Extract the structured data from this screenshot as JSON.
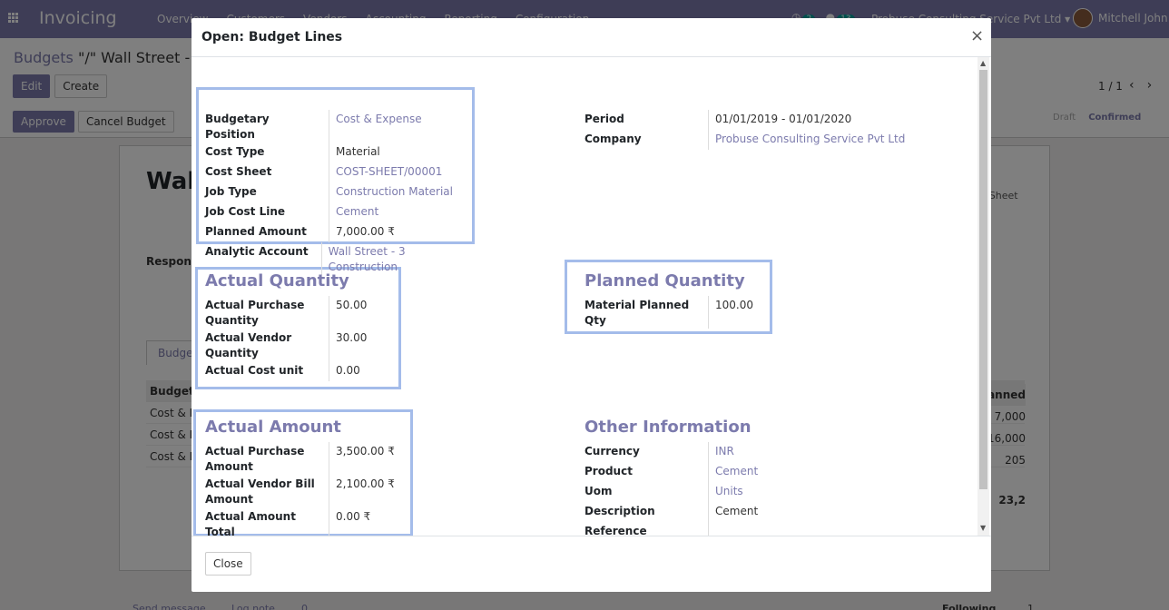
{
  "app": {
    "brand": "Invoicing",
    "menu": [
      "Overview",
      "Customers",
      "Vendors",
      "Accounting",
      "Reporting",
      "Configuration"
    ],
    "activity_count": "2",
    "message_count": "13",
    "company": "Probuse Consulting Service Pvt Ltd",
    "user": "Mitchell John"
  },
  "control_panel": {
    "breadcrumb_parent": "Budgets",
    "breadcrumb_current": "\"/\" Wall Street - 3 C",
    "edit_label": "Edit",
    "create_label": "Create",
    "pager": "1 / 1",
    "approve_label": "Approve",
    "cancel_budget_label": "Cancel Budget",
    "stage_draft": "Draft",
    "stage_confirmed": "Confirmed"
  },
  "sheet": {
    "title": "Wall",
    "responsible_label": "Respons",
    "tab_label": "Budget",
    "right_label_1": "t Sheet",
    "right_label_2": "s",
    "table_header": "Budgeta",
    "table_header_right": "lanned",
    "rows": [
      "Cost & E",
      "Cost & E",
      "Cost & E"
    ],
    "right_values": [
      "7,000",
      "16,000",
      "205"
    ],
    "total": "23,2"
  },
  "footer": {
    "send_message": "Send message",
    "log_note": "Log note",
    "attachments": "0",
    "following": "Following",
    "followers": "1"
  },
  "modal": {
    "title": "Open: Budget Lines",
    "close_label": "Close",
    "main_fields": [
      {
        "label": "Budgetary Position",
        "value": "Cost & Expense",
        "link": true
      },
      {
        "label": "Cost Type",
        "value": "Material",
        "link": false
      },
      {
        "label": "Cost Sheet",
        "value": "COST-SHEET/00001",
        "link": true
      },
      {
        "label": "Job Type",
        "value": "Construction Material",
        "link": true
      },
      {
        "label": "Job Cost Line",
        "value": "Cement",
        "link": true
      },
      {
        "label": "Planned Amount",
        "value": "7,000.00 ₹",
        "link": false
      },
      {
        "label": "Analytic Account",
        "value": "Wall Street - 3 Construction",
        "link": true
      }
    ],
    "right_fields": [
      {
        "label": "Period",
        "value": "01/01/2019 - 01/01/2020",
        "link": false
      },
      {
        "label": "Company",
        "value": "Probuse Consulting Service Pvt Ltd",
        "link": true
      }
    ],
    "actual_quantity": {
      "title": "Actual Quantity",
      "fields": [
        {
          "label": "Actual Purchase Quantity",
          "value": "50.00"
        },
        {
          "label": "Actual Vendor Quantity",
          "value": "30.00"
        },
        {
          "label": "Actual Cost unit",
          "value": "0.00"
        }
      ]
    },
    "planned_quantity": {
      "title": "Planned Quantity",
      "fields": [
        {
          "label": "Material Planned Qty",
          "value": "100.00"
        }
      ]
    },
    "actual_amount": {
      "title": "Actual Amount",
      "fields": [
        {
          "label": "Actual Purchase Amount",
          "value": "3,500.00 ₹"
        },
        {
          "label": "Actual Vendor Bill Amount",
          "value": "2,100.00 ₹"
        },
        {
          "label": "Actual Amount Total",
          "value": "0.00 ₹"
        }
      ]
    },
    "other_information": {
      "title": "Other Information",
      "fields": [
        {
          "label": "Currency",
          "value": "INR",
          "link": true
        },
        {
          "label": "Product",
          "value": "Cement",
          "link": true
        },
        {
          "label": "Uom",
          "value": "Units",
          "link": true
        },
        {
          "label": "Description",
          "value": "Cement",
          "link": false
        },
        {
          "label": "Reference",
          "value": "",
          "link": false
        }
      ]
    },
    "highlight_color": "#a4bcea",
    "accent_color": "#7c7bad"
  }
}
